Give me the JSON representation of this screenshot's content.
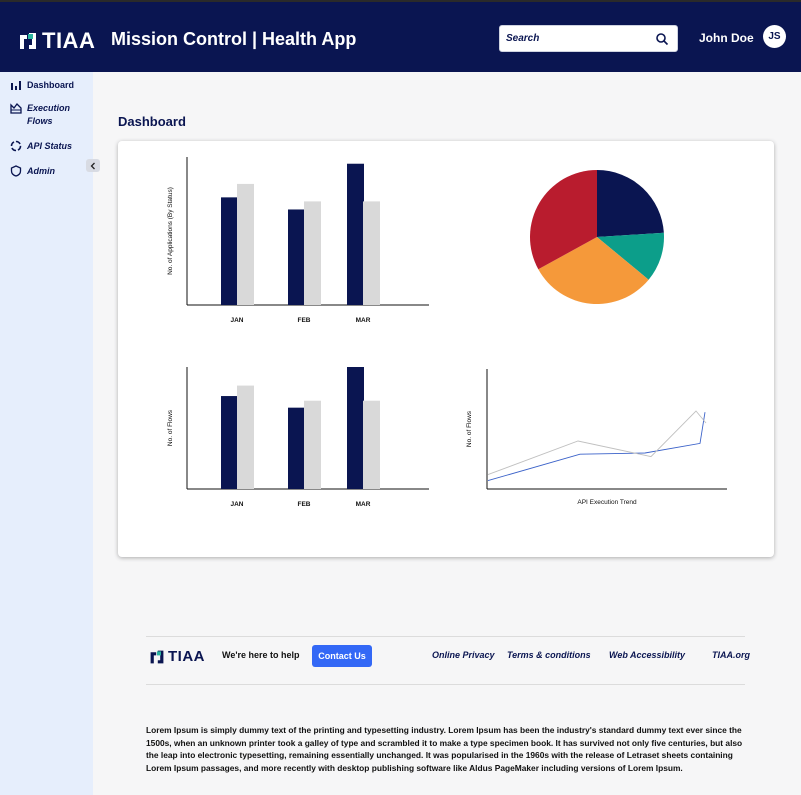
{
  "header": {
    "logo_text": "TIAA",
    "app_title": "Mission Control | Health App",
    "search_placeholder": "Search",
    "user_name": "John Doe",
    "user_initials": "JS"
  },
  "sidebar": {
    "items": [
      {
        "label": "Dashboard",
        "icon": "bar-chart-icon"
      },
      {
        "label": "Execution Flows",
        "icon": "flows-icon"
      },
      {
        "label": "API Status",
        "icon": "status-icon"
      },
      {
        "label": "Admin",
        "icon": "shield-icon"
      }
    ]
  },
  "main": {
    "page_title": "Dashboard"
  },
  "colors": {
    "navy": "#0a1551",
    "gray_bar": "#d9d9d9",
    "teal": "#0c9e8a",
    "orange": "#f5993a",
    "red": "#b91c2e",
    "contact_blue": "#3368f6"
  },
  "chart_data": [
    {
      "type": "bar",
      "categories": [
        "JAN",
        "FEB",
        "MAR"
      ],
      "series": [
        {
          "values": [
            80,
            71,
            105
          ]
        },
        {
          "values": [
            90,
            77,
            77
          ]
        }
      ],
      "ylabel": "No. of Applications (By Status)",
      "xlabel": "",
      "ylim": [
        0,
        110
      ]
    },
    {
      "type": "pie",
      "values": [
        24,
        12,
        31,
        33
      ]
    },
    {
      "type": "bar",
      "categories": [
        "JAN",
        "FEB",
        "MAR"
      ],
      "series": [
        {
          "values": [
            80,
            70,
            105
          ]
        },
        {
          "values": [
            89,
            76,
            76
          ]
        }
      ],
      "ylabel": "No. of Flows",
      "xlabel": "",
      "ylim": [
        0,
        105
      ]
    },
    {
      "type": "line",
      "x": [
        1,
        2,
        3,
        4,
        5
      ],
      "series": [
        {
          "values": [
            7,
            29,
            30,
            38,
            64
          ]
        },
        {
          "values": [
            12,
            40,
            27,
            65,
            55
          ]
        }
      ],
      "ylabel": "No. of Flows",
      "xlabel": "API Execution Trend",
      "ylim": [
        0,
        100
      ]
    }
  ],
  "footer": {
    "logo_text": "TIAA",
    "help_text": "We're here to help",
    "contact_label": "Contact Us",
    "links": [
      "Online Privacy",
      "Terms & conditions",
      "Web Accessibility",
      "TIAA.org"
    ],
    "lorem": "Lorem Ipsum is simply dummy text of the printing and typesetting industry. Lorem Ipsum has been the industry's standard dummy text ever since the 1500s, when an unknown printer took a galley of type and scrambled it to make a type specimen book. It has survived not only five centuries, but also the leap into electronic typesetting, remaining essentially unchanged. It was popularised in the 1960s with the release of Letraset sheets containing Lorem Ipsum passages, and more recently with desktop publishing software like Aldus PageMaker including versions of Lorem Ipsum."
  }
}
